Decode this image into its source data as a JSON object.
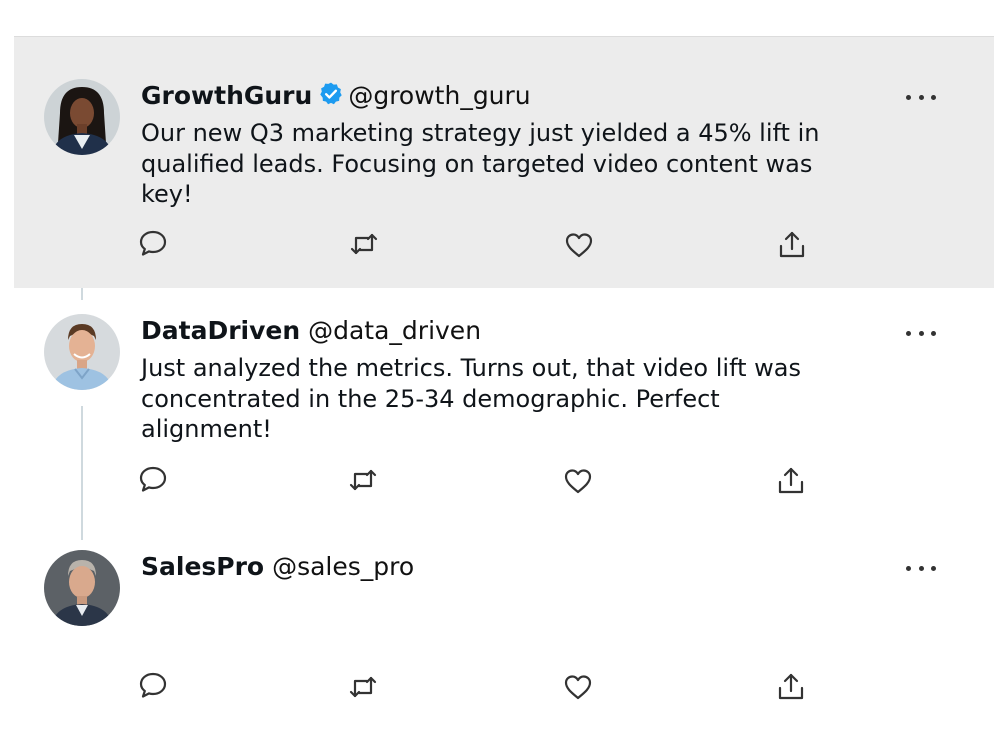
{
  "tweets": [
    {
      "display_name": "GrowthGuru",
      "handle": "@growth_guru",
      "verified": true,
      "avatar": "woman-portrait-avatar",
      "text": "Our new Q3 marketing strategy just yielded a 45% lift in\nqualified leads. Focusing on targeted video content was\nkey!"
    },
    {
      "display_name": "DataDriven",
      "handle": "@data_driven",
      "verified": false,
      "avatar": "man-portrait-avatar",
      "text": "Just analyzed the metrics. Turns out, that video lift was\nconcentrated in the 25-34 demographic. Perfect\nalignment!"
    },
    {
      "display_name": "SalesPro",
      "handle": "@sales_pro",
      "verified": false,
      "avatar": "older-man-portrait-avatar",
      "text": ""
    }
  ],
  "icons": {
    "reply": "reply-icon",
    "retweet": "retweet-icon",
    "like": "like-icon",
    "share": "share-icon",
    "more": "more-options-icon",
    "verified": "verified-badge-icon"
  },
  "colors": {
    "highlight_background": "#ececec",
    "verified_blue": "#1d9bf0",
    "text": "#0f1419",
    "icon": "#333333",
    "thread_line": "#cfd9de"
  }
}
